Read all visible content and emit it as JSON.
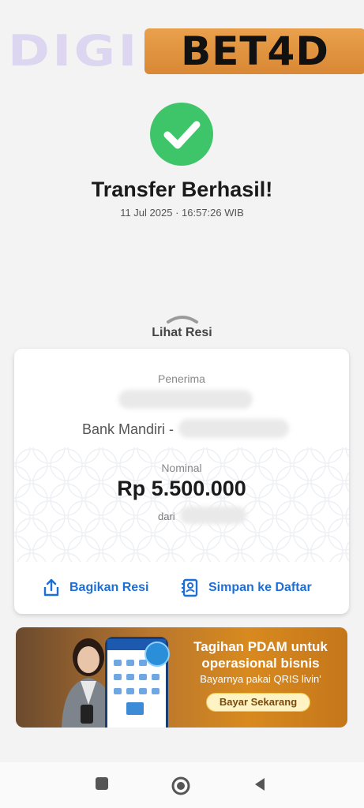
{
  "logo": {
    "part1": "DIGI",
    "part2": "BET4D"
  },
  "status": {
    "title": "Transfer Berhasil!",
    "datetime": "11 Jul 2025 · 16:57:26 WIB"
  },
  "receipt_toggle": "Lihat Resi",
  "receipt": {
    "recipient_label": "Penerima",
    "bank_prefix": "Bank Mandiri -",
    "nominal_label": "Nominal",
    "amount": "Rp 5.500.000",
    "from_label": "dari"
  },
  "actions": {
    "share_label": "Bagikan Resi",
    "save_label": "Simpan ke Daftar"
  },
  "banner": {
    "title_line1": "Tagihan PDAM untuk",
    "title_line2": "operasional bisnis",
    "subtitle": "Bayarnya pakai QRIS livin'",
    "button_label": "Bayar Sekarang"
  },
  "colors": {
    "success": "#3fc569",
    "accent": "#1c6fd6",
    "logo_orange": "#e09440"
  },
  "icons": {
    "status": "check-circle-icon",
    "share": "share-upload-icon",
    "save": "contact-save-icon",
    "nav_recent": "square-icon",
    "nav_home": "circle-icon",
    "nav_back": "triangle-back-icon"
  }
}
